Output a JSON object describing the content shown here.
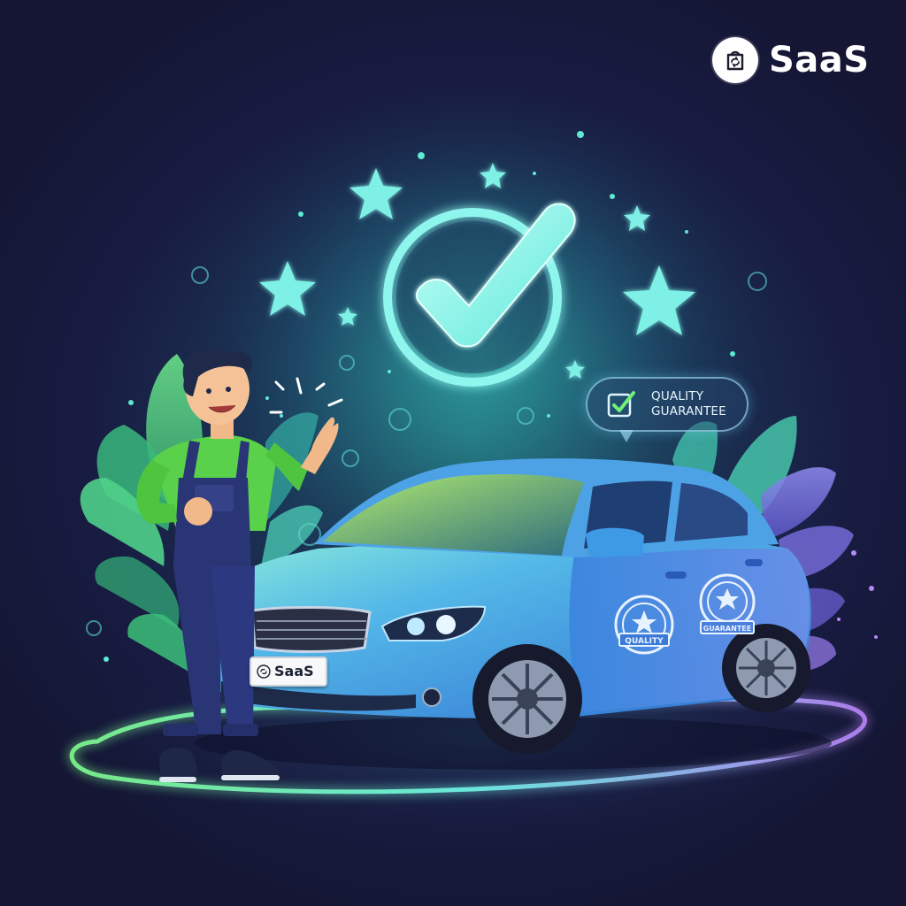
{
  "brand": {
    "name": "SaaS",
    "logo_icon": "bag-sync-icon"
  },
  "hero": {
    "center_icon": "check-circle-icon",
    "decorations": [
      "star-icon",
      "sparkle-dots",
      "bubbles",
      "leaves"
    ]
  },
  "quality_badge": {
    "icon": "checkbox-icon",
    "line1": "QUALITY",
    "line2": "GUARANTEE"
  },
  "car": {
    "plate_text": "SaaS",
    "seal_front": "QUALITY",
    "seal_rear": "GUARANTEE"
  },
  "colors": {
    "background": "#181c42",
    "accent_glow": "#5ef0e4",
    "brand_green": "#4cd65a",
    "car_blue": "#3f8fe0",
    "loop_start": "#7cf58c",
    "loop_end": "#b582f5"
  }
}
